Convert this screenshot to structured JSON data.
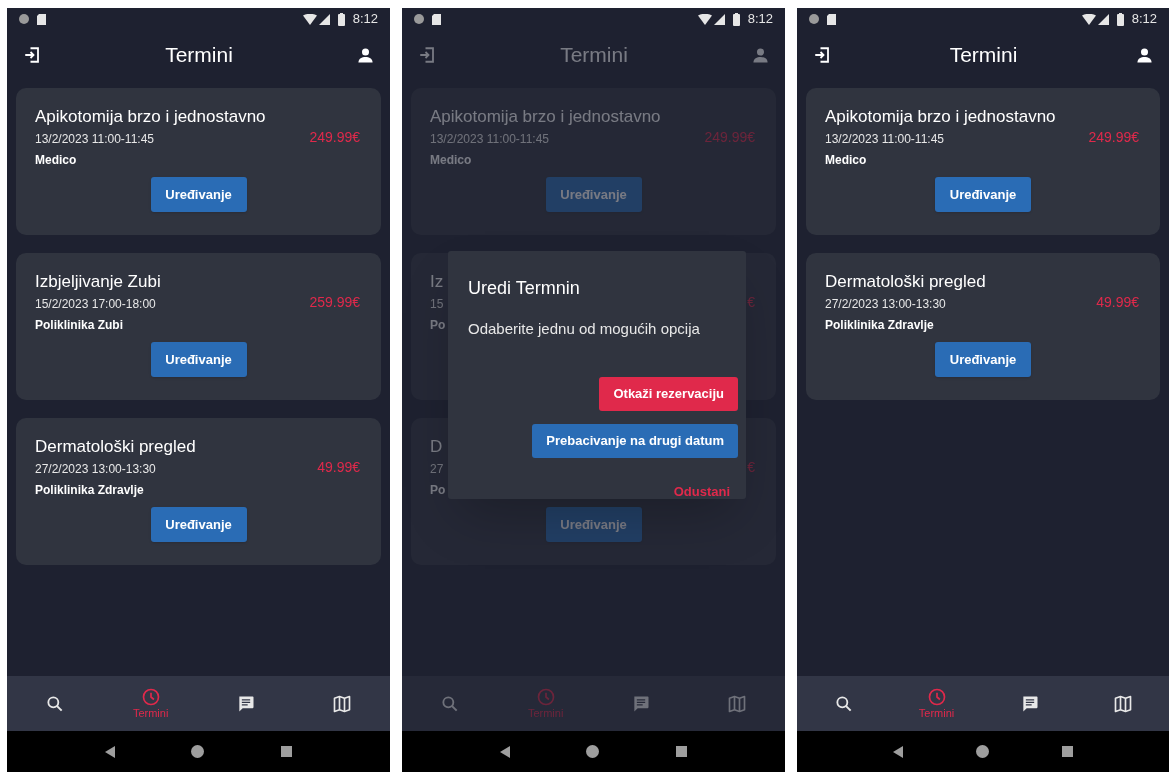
{
  "screens": [
    {
      "status_time": "8:12",
      "title": "Termini",
      "dimmed": false,
      "cards": [
        {
          "title": "Apikotomija brzo i jednostavno",
          "date": "13/2/2023 11:00-11:45",
          "provider": "Medico",
          "price": "249.99€",
          "button": "Uređivanje"
        },
        {
          "title": "Izbjeljivanje Zubi",
          "date": "15/2/2023 17:00-18:00",
          "provider": "Poliklinika Zubi",
          "price": "259.99€",
          "button": "Uređivanje"
        },
        {
          "title": "Dermatološki pregled",
          "date": "27/2/2023 13:00-13:30",
          "provider": "Poliklinika Zdravlje",
          "price": "49.99€",
          "button": "Uređivanje"
        }
      ],
      "nav": [
        {
          "kind": "search",
          "selected": false
        },
        {
          "kind": "appointments",
          "label": "Termini",
          "selected": true
        },
        {
          "kind": "chat",
          "selected": false
        },
        {
          "kind": "map",
          "selected": false
        }
      ]
    },
    {
      "status_time": "8:12",
      "title": "Termini",
      "dimmed": true,
      "cards": [
        {
          "title": "Apikotomija brzo i jednostavno",
          "date": "13/2/2023 11:00-11:45",
          "provider": "Medico",
          "price": "249.99€",
          "button": "Uređivanje"
        },
        {
          "title": "Iz",
          "date": "15",
          "provider": "Po",
          "price": "€"
        },
        {
          "title": "D",
          "date": "27",
          "provider": "Po",
          "price": "€",
          "button": "Uređivanje"
        }
      ],
      "nav": [
        {
          "kind": "search",
          "selected": false
        },
        {
          "kind": "appointments",
          "label": "Termini",
          "selected": true
        },
        {
          "kind": "chat",
          "selected": false
        },
        {
          "kind": "map",
          "selected": false
        }
      ],
      "dialog": {
        "title": "Uredi Termnin",
        "message": "Odaberite jednu od mogućih opcija",
        "actions": [
          {
            "kind": "danger",
            "label": "Otkaži rezervaciju"
          },
          {
            "kind": "primary",
            "label": "Prebacivanje na drugi datum"
          },
          {
            "kind": "text",
            "label": "Odustani"
          }
        ]
      }
    },
    {
      "status_time": "8:12",
      "title": "Termini",
      "dimmed": false,
      "cards": [
        {
          "title": "Apikotomija brzo i jednostavno",
          "date": "13/2/2023 11:00-11:45",
          "provider": "Medico",
          "price": "249.99€",
          "button": "Uređivanje"
        },
        {
          "title": "Dermatološki pregled",
          "date": "27/2/2023 13:00-13:30",
          "provider": "Poliklinika Zdravlje",
          "price": "49.99€",
          "button": "Uređivanje"
        }
      ],
      "nav": [
        {
          "kind": "search",
          "selected": false
        },
        {
          "kind": "appointments",
          "label": "Termini",
          "selected": true
        },
        {
          "kind": "chat",
          "selected": false
        },
        {
          "kind": "map",
          "selected": false
        }
      ]
    }
  ]
}
